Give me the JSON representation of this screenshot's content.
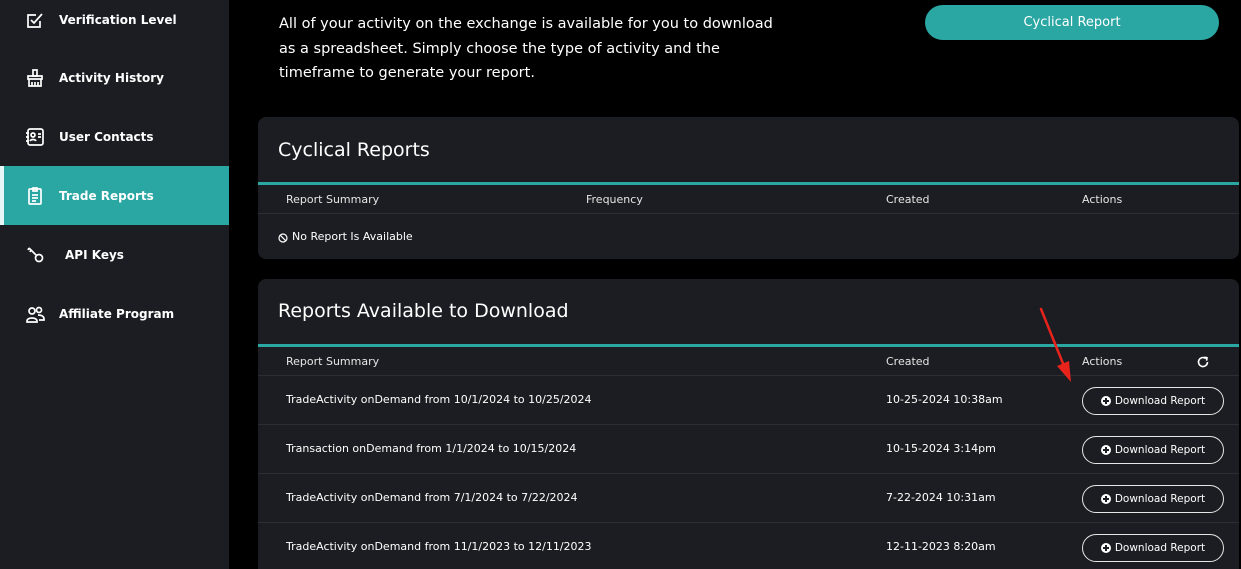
{
  "sidebar": {
    "items": [
      {
        "label": "Verification Level",
        "icon": "checkbox-edit-icon"
      },
      {
        "label": "Activity History",
        "icon": "broom-icon"
      },
      {
        "label": "User Contacts",
        "icon": "contact-card-icon"
      },
      {
        "label": "Trade Reports",
        "icon": "clipboard-icon",
        "active": true
      },
      {
        "label": "API Keys",
        "icon": "key-icon"
      },
      {
        "label": "Affiliate Program",
        "icon": "users-icon"
      }
    ]
  },
  "intro": {
    "line1": "All of your activity on the exchange is available for you to download",
    "line2": "as a spreadsheet. Simply choose the type of activity and the",
    "line3": "timeframe to generate your report."
  },
  "top_button": {
    "label": "Cyclical Report"
  },
  "cyclical": {
    "title": "Cyclical Reports",
    "headers": {
      "summary": "Report Summary",
      "frequency": "Frequency",
      "created": "Created",
      "actions": "Actions"
    },
    "empty_text": "No Report Is Available"
  },
  "downloads": {
    "title": "Reports Available to Download",
    "headers": {
      "summary": "Report Summary",
      "created": "Created",
      "actions": "Actions"
    },
    "download_label": "Download Report",
    "rows": [
      {
        "summary": "TradeActivity onDemand from 10/1/2024 to 10/25/2024",
        "created": "10-25-2024 10:38am"
      },
      {
        "summary": "Transaction onDemand from 1/1/2024 to 10/15/2024",
        "created": "10-15-2024 3:14pm"
      },
      {
        "summary": "TradeActivity onDemand from 7/1/2024 to 7/22/2024",
        "created": "7-22-2024 10:31am"
      },
      {
        "summary": "TradeActivity onDemand from 11/1/2023 to 12/11/2023",
        "created": "12-11-2023 8:20am"
      }
    ]
  },
  "colors": {
    "accent": "#2aa6a3",
    "card": "#1c1d22",
    "arrow": "#e8231c"
  }
}
